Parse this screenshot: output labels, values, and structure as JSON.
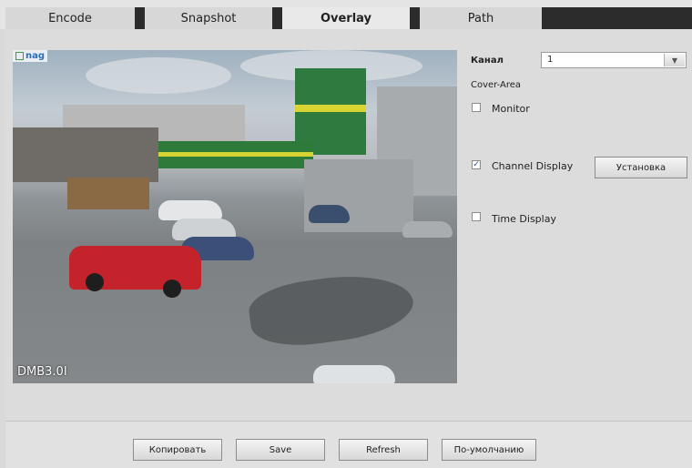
{
  "tabs": [
    {
      "label": "Encode",
      "active": false
    },
    {
      "label": "Snapshot",
      "active": false
    },
    {
      "label": "Overlay",
      "active": true
    },
    {
      "label": "Path",
      "active": false
    }
  ],
  "preview": {
    "logo_text": "nag",
    "channel_title": "DMB3.0I"
  },
  "settings": {
    "channel_label": "Канал",
    "channel_value": "1",
    "cover_area_label": "Cover-Area",
    "monitor_label": "Monitor",
    "monitor_checked": false,
    "channel_display_label": "Channel Display",
    "channel_display_checked": true,
    "setup_button_label": "Установка",
    "time_display_label": "Time Display",
    "time_display_checked": false
  },
  "actions": {
    "copy_label": "Копировать",
    "save_label": "Save",
    "refresh_label": "Refresh",
    "default_label": "По-умолчанию"
  },
  "icons": {
    "dropdown": "chevron-down-icon",
    "check": "checkmark-icon"
  },
  "colors": {
    "tab_separator": "#2c2c2c",
    "panel_bg": "#dcdcdc",
    "overlay_text": "#ffffff"
  }
}
